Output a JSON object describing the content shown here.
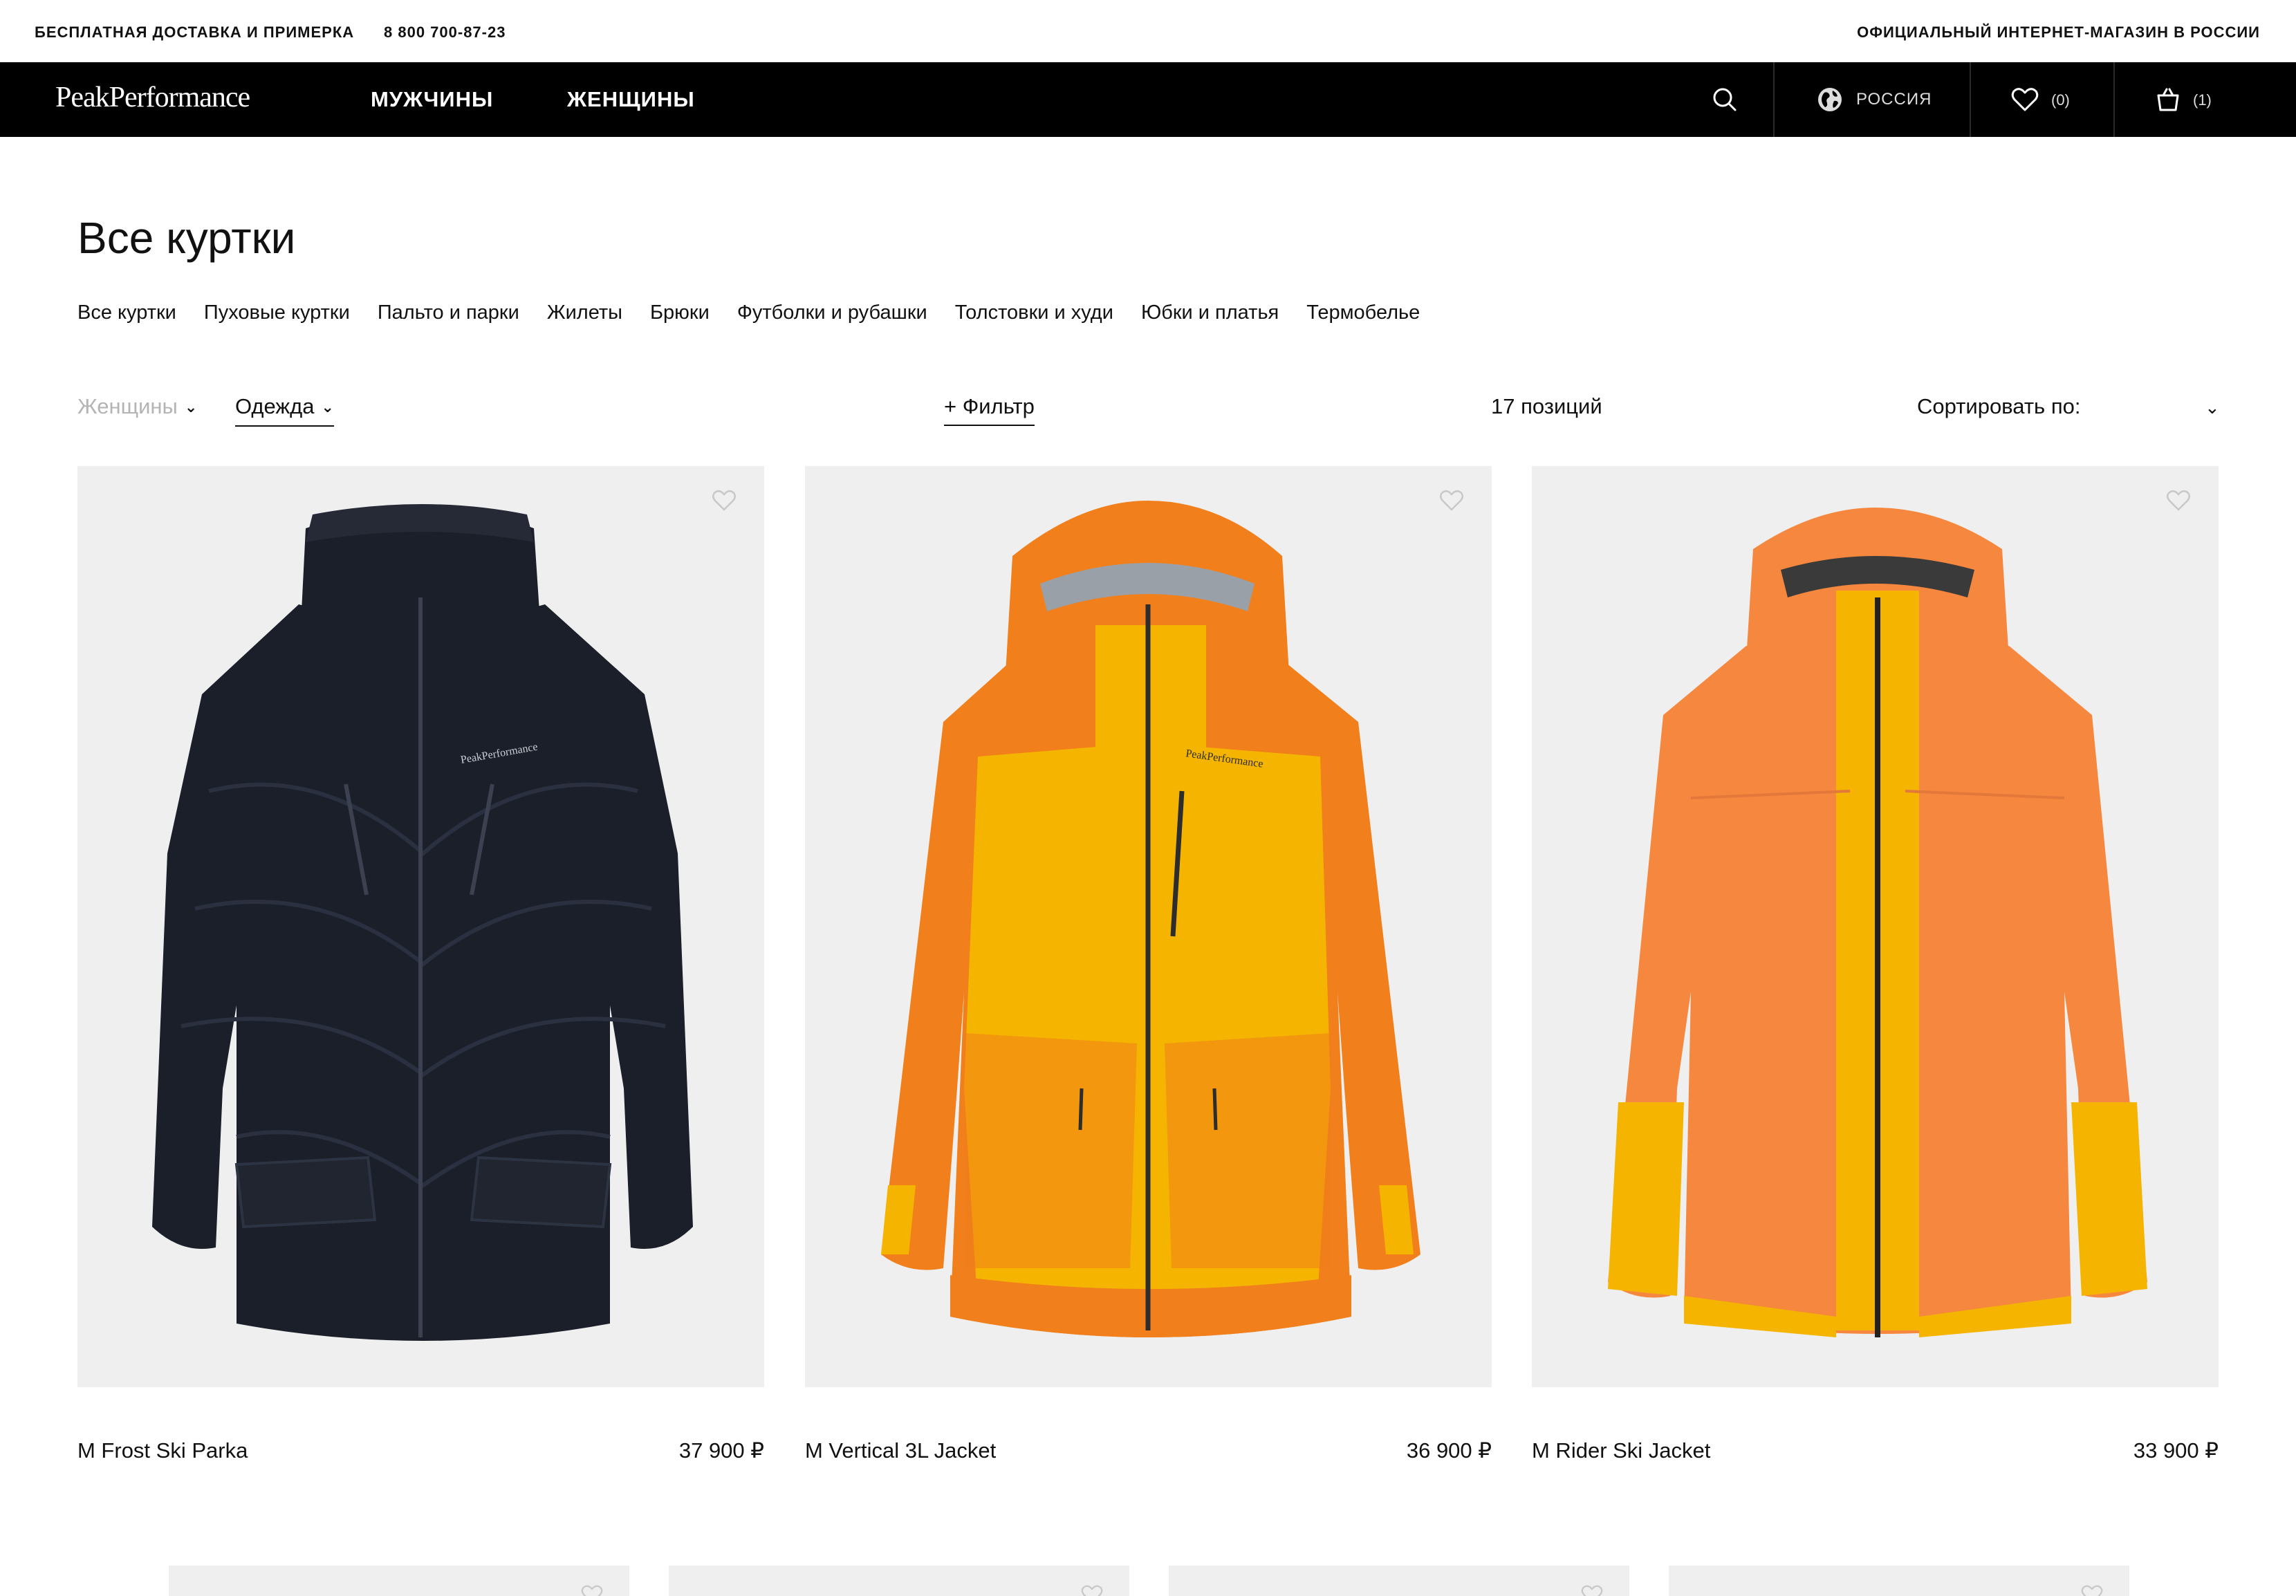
{
  "topbar": {
    "delivery": "БЕСПЛАТНАЯ ДОСТАВКА И ПРИМЕРКА",
    "phone": "8 800 700-87-23",
    "official": "ОФИЦИАЛЬНЫЙ ИНТЕРНЕТ-МАГАЗИН В РОССИИ"
  },
  "nav": {
    "logo": "PeakPerformance",
    "men": "МУЖЧИНЫ",
    "women": "ЖЕНЩИНЫ",
    "search_icon": "search-icon",
    "region": "РОССИЯ",
    "wishlist_count": "(0)",
    "cart_count": "(1)"
  },
  "page": {
    "title": "Все куртки",
    "subcategories": [
      "Все куртки",
      "Пуховые куртки",
      "Пальто и парки",
      "Жилеты",
      "Брюки",
      "Футболки и рубашки",
      "Толстовки и худи",
      "Юбки и платья",
      "Термобелье"
    ]
  },
  "filters": {
    "gender": "Женщины",
    "type": "Одежда",
    "filter": "+ Фильтр",
    "count": "17 позиций",
    "sort": "Сортировать по:"
  },
  "products": [
    {
      "name": "M Frost Ski Parka",
      "price": "37 900 ₽",
      "color": "#1b1f2a"
    },
    {
      "name": "M Vertical 3L Jacket",
      "price": "36 900 ₽",
      "color": "#f2b400"
    },
    {
      "name": "M Rider Ski Jacket",
      "price": "33 900 ₽",
      "color": "#f5873e"
    }
  ],
  "colors": {
    "nav_bg": "#000000",
    "card_bg": "#efefef",
    "muted_text": "#b4b4b4"
  }
}
